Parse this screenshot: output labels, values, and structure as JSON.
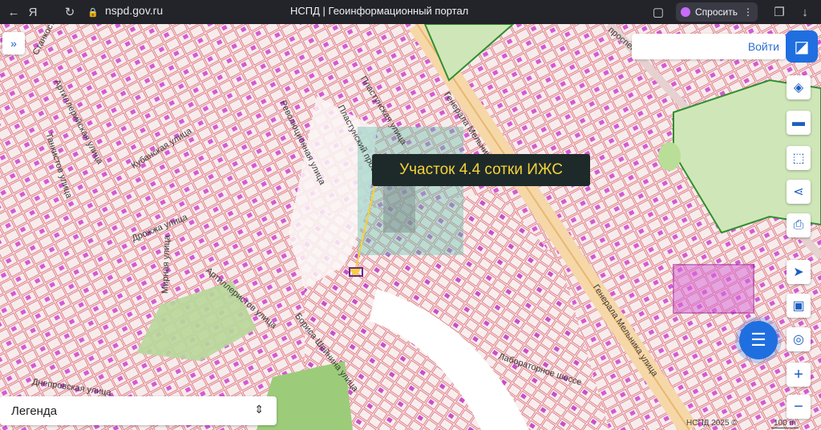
{
  "browser": {
    "url": "nspd.gov.ru",
    "title": "НСПД | Геоинформационный портал",
    "ask_label": "Спросить"
  },
  "map": {
    "callout": "Участок 4.4 сотки ИЖС",
    "streets": {
      "dopolnitelnaya": "Краснодонская улица",
      "stankostroitelnaya": "Станкостроительная улица",
      "artilleriyskaya_1": "Артиллерийская улица",
      "tankistov": "Танкистов улица",
      "kubanskaya": "Кубанская улица",
      "revolyutsii": "Революционная улица",
      "mirnaya": "Мирная улица",
      "drozhzha": "Дрожжа улица",
      "artilleristov": "Артиллеристов улица",
      "borisa": "Бориса Шейнина улица",
      "dneprovskaya": "Днепровская улица",
      "laboratornoe": "Лабораторное шоссе",
      "generala_melnika_1": "Генерала Мельника",
      "generala_melnika_2": "Генерала Мельника улица",
      "plastunskaya": "Пластунская улица",
      "plastunskiy": "Пластунский проезд",
      "prospekt": "проспект"
    },
    "copyright": "НСПД 2025 ©",
    "scale": "100 m"
  },
  "controls": {
    "login": "Войти",
    "legend": "Легенда"
  }
}
